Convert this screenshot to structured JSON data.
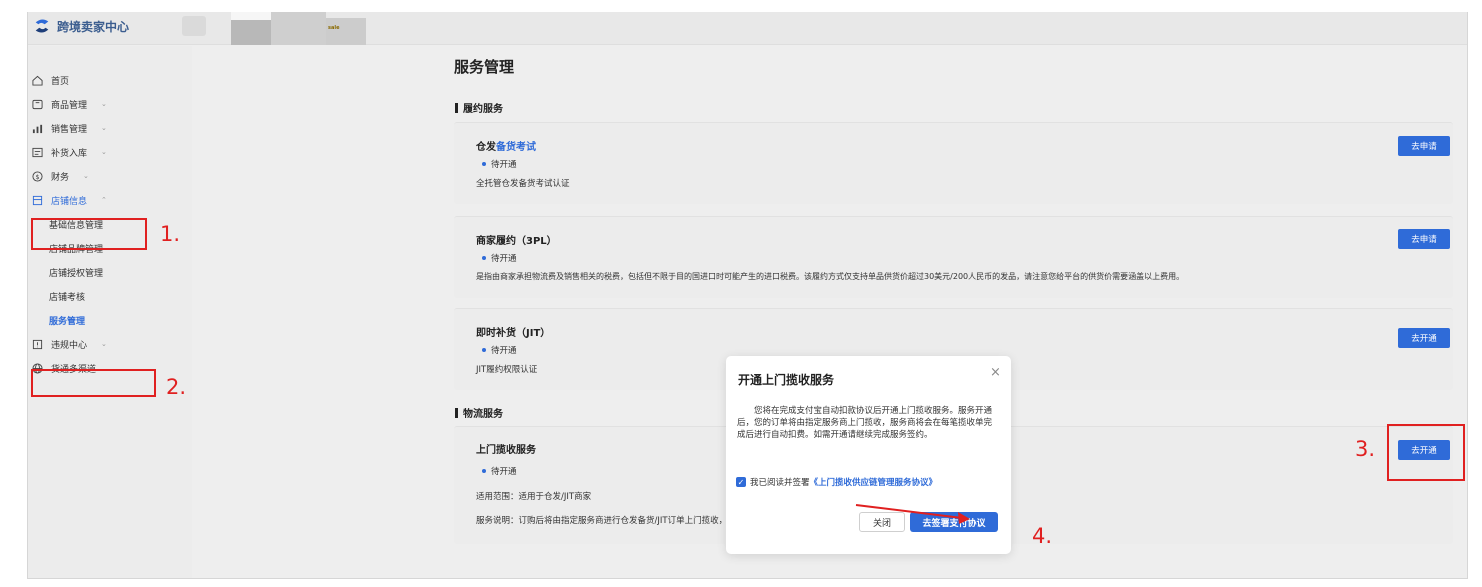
{
  "topbar": {
    "logo_text": "跨境卖家中心",
    "badge_text": "sale"
  },
  "sidebar": {
    "items": [
      {
        "label": "首页",
        "icon": "home-icon"
      },
      {
        "label": "商品管理",
        "icon": "product-icon",
        "chevron": "⌄"
      },
      {
        "label": "销售管理",
        "icon": "sales-icon",
        "chevron": "⌄"
      },
      {
        "label": "补货入库",
        "icon": "inbound-icon",
        "chevron": "⌄"
      },
      {
        "label": "财务",
        "icon": "finance-icon",
        "chevron": "⌄"
      },
      {
        "label": "店铺信息",
        "icon": "store-icon",
        "chevron": "⌃"
      },
      {
        "label": "违规中心",
        "icon": "violation-icon",
        "chevron": "⌄"
      },
      {
        "label": "货通多渠道",
        "icon": "globe-icon"
      }
    ],
    "sub_items": [
      "基础信息管理",
      "店铺品牌管理",
      "店铺授权管理",
      "店铺考核",
      "服务管理"
    ]
  },
  "main": {
    "title": "服务管理",
    "sections": [
      {
        "title": "履约服务"
      },
      {
        "title": "物流服务"
      }
    ],
    "cards": [
      {
        "title_prefix": "仓发",
        "title_highlight": "备货考试",
        "status": "待开通",
        "desc": "全托管仓发备货考试认证",
        "button": "去申请"
      },
      {
        "title": "商家履约（3PL）",
        "status": "待开通",
        "desc": "是指由商家承担物流费及销售相关的税费，包括但不限于目的国进口时可能产生的进口税费。该履约方式仅支持单品供货价超过30美元/200人民币的发品，请注意您给平台的供货价需要涵盖以上费用。",
        "button": "去申请"
      },
      {
        "title": "即时补货（JIT）",
        "status": "待开通",
        "desc": "JIT履约权限认证",
        "button": "去开通"
      },
      {
        "title": "上门揽收服务",
        "status": "待开通",
        "desc1": "适用范围：适用于仓发/JIT商家",
        "desc2": "服务说明：订购后将由指定服务商进行仓发备货/JIT订单上门揽收，",
        "button": "去开通"
      }
    ]
  },
  "dialog": {
    "title": "开通上门揽收服务",
    "close_symbol": "×",
    "body": "您将在完成支付宝自动扣款协议后开通上门揽收服务。服务开通后，您的订单将由指定服务商上门揽收，服务商将会在每笔揽收单完成后进行自动扣费。如需开通请继续完成服务签约。",
    "agree_prefix": "我已阅读并签署",
    "agree_link": "《上门揽收供应链管理服务协议》",
    "check_symbol": "✓",
    "cancel_label": "关闭",
    "confirm_label": "去签署支付协议"
  },
  "annotations": {
    "step1": "1.",
    "step2": "2.",
    "step3": "3.",
    "step4": "4.",
    "color": "#e02020"
  },
  "colors": {
    "accent": "#2f6bd8",
    "background": "#eeeeee"
  }
}
